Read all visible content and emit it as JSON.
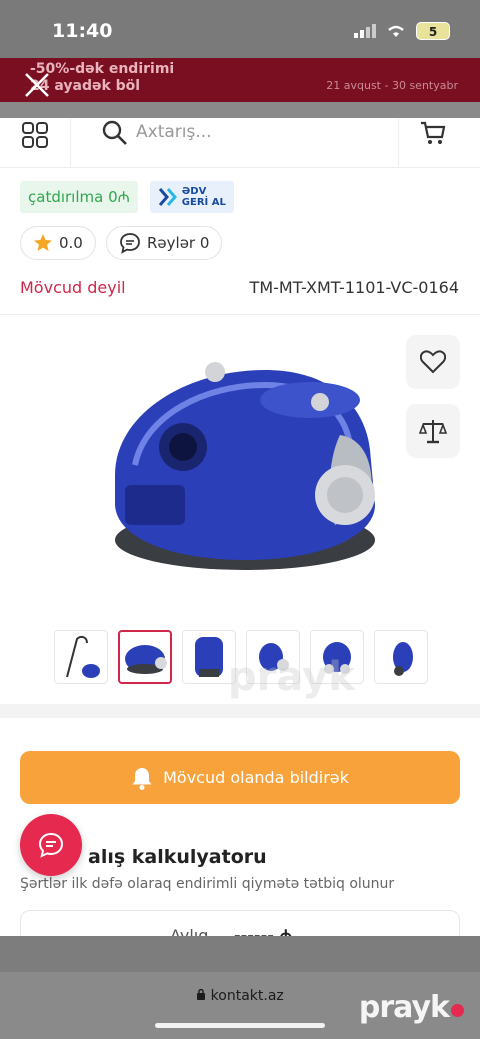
{
  "status": {
    "time": "11:40",
    "battery": "5"
  },
  "promo": {
    "text": "-50%-dək endirimi\n24 ayadək böl",
    "dates": "21 avqust - 30 sentyabr"
  },
  "header": {
    "search_placeholder": "Axtarış..."
  },
  "badges": {
    "delivery": "çatdırılma 0₼",
    "return_line1": "ƏDV",
    "return_line2": "GERİ AL"
  },
  "rating": {
    "value": "0.0",
    "reviews": "Rəylər 0"
  },
  "product": {
    "availability": "Mövcud deyil",
    "sku": "TM-MT-XMT-1101-VC-0164"
  },
  "notify_button": "Mövcud olanda bildirək",
  "calculator": {
    "title": "alış kalkulyatoru",
    "subtitle": "Şərtlər ilk dəfə olaraq endirimli qiymətə tətbiq olunur",
    "month_label": "Aylıq",
    "month_value": "------ ₼"
  },
  "browser": {
    "url": "kontakt.az"
  },
  "watermark": "prayk",
  "colors": {
    "accent": "#e5294f",
    "orange": "#f7a23b",
    "green": "#2ea84f",
    "banner": "#7a0f22"
  }
}
